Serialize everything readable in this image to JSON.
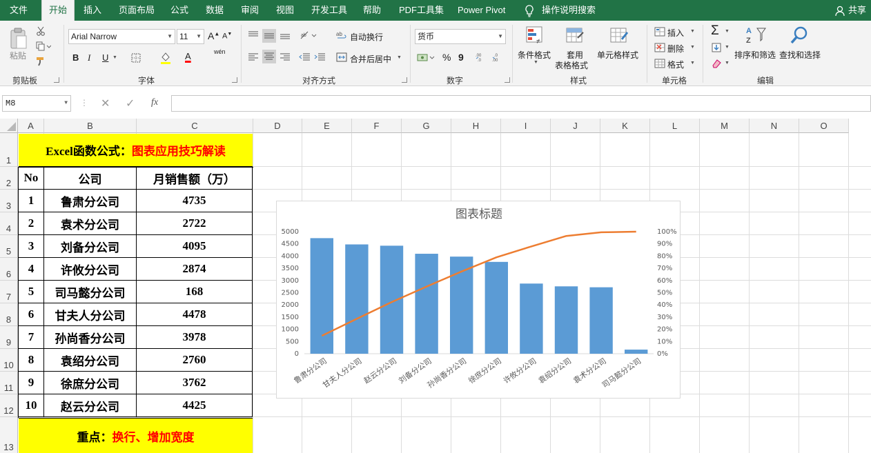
{
  "menu": {
    "tabs": [
      "文件",
      "开始",
      "插入",
      "页面布局",
      "公式",
      "数据",
      "审阅",
      "视图",
      "开发工具",
      "帮助",
      "PDF工具集",
      "Power Pivot"
    ],
    "active_tab": "开始",
    "tell_me": "操作说明搜索",
    "share": "共享"
  },
  "ribbon": {
    "clipboard": {
      "paste": "粘贴",
      "label": "剪贴板"
    },
    "font": {
      "name": "Arial Narrow",
      "size": "11",
      "grow": "A",
      "shrink": "A",
      "bold": "B",
      "italic": "I",
      "underline": "U",
      "color_letter": "A",
      "wen": "wén",
      "label": "字体"
    },
    "alignment": {
      "wrap": "自动换行",
      "merge": "合并后居中",
      "label": "对齐方式"
    },
    "number": {
      "format": "货币",
      "percent": "%",
      "comma": "9",
      "label": "数字"
    },
    "styles": {
      "conditional": "条件格式",
      "table1": "套用",
      "table2": "表格格式",
      "cell_styles": "单元格样式",
      "label": "样式"
    },
    "cells": {
      "insert": "插入",
      "delete": "删除",
      "format": "格式",
      "label": "单元格"
    },
    "editing": {
      "sort": "排序和筛选",
      "find": "查找和选择",
      "label": "编辑"
    }
  },
  "formula_bar": {
    "name_box": "M8",
    "fx": "fx",
    "value": ""
  },
  "columns": [
    "A",
    "B",
    "C",
    "D",
    "E",
    "F",
    "G",
    "H",
    "I",
    "J",
    "K",
    "L",
    "M",
    "N",
    "O"
  ],
  "rows": [
    "1",
    "2",
    "3",
    "4",
    "5",
    "6",
    "7",
    "8",
    "9",
    "10",
    "11",
    "12",
    "13"
  ],
  "sheet": {
    "title_black": "Excel函数公式：",
    "title_red": "图表应用技巧解读",
    "headers": [
      "No",
      "公司",
      "月销售额（万）"
    ],
    "data": [
      {
        "no": "1",
        "company": "鲁肃分公司",
        "sales": "4735"
      },
      {
        "no": "2",
        "company": "袁术分公司",
        "sales": "2722"
      },
      {
        "no": "3",
        "company": "刘备分公司",
        "sales": "4095"
      },
      {
        "no": "4",
        "company": "许攸分公司",
        "sales": "2874"
      },
      {
        "no": "5",
        "company": "司马懿分公司",
        "sales": "168"
      },
      {
        "no": "6",
        "company": "甘夫人分公司",
        "sales": "4478"
      },
      {
        "no": "7",
        "company": "孙尚香分公司",
        "sales": "3978"
      },
      {
        "no": "8",
        "company": "袁绍分公司",
        "sales": "2760"
      },
      {
        "no": "9",
        "company": "徐庶分公司",
        "sales": "3762"
      },
      {
        "no": "10",
        "company": "赵云分公司",
        "sales": "4425"
      }
    ],
    "footer_black": "重点：",
    "footer_red": "换行、增加宽度"
  },
  "colors": {
    "excel_green": "#217346",
    "bar": "#5b9bd5",
    "line": "#ed7d31",
    "yellow": "#ffff00",
    "red": "#ff0000"
  },
  "chart_data": {
    "type": "bar",
    "title": "图表标题",
    "categories": [
      "鲁肃分公司",
      "甘夫人分公司",
      "赵云分公司",
      "刘备分公司",
      "孙尚香分公司",
      "徐庶分公司",
      "许攸分公司",
      "袁绍分公司",
      "袁术分公司",
      "司马懿分公司"
    ],
    "series": [
      {
        "type": "bar",
        "axis": "primary",
        "values": [
          4735,
          4478,
          4425,
          4095,
          3978,
          3762,
          2874,
          2760,
          2722,
          168
        ]
      },
      {
        "type": "line",
        "axis": "secondary",
        "values": [
          0.1469,
          0.2858,
          0.423,
          0.55,
          0.6734,
          0.7901,
          0.8792,
          0.9648,
          0.9948,
          1.0
        ]
      }
    ],
    "ylim": [
      0,
      5000
    ],
    "yticks": [
      "0",
      "500",
      "1000",
      "1500",
      "2000",
      "2500",
      "3000",
      "3500",
      "4000",
      "4500",
      "5000"
    ],
    "y2lim": [
      0,
      1
    ],
    "y2ticks": [
      "0%",
      "10%",
      "20%",
      "30%",
      "40%",
      "50%",
      "60%",
      "70%",
      "80%",
      "90%",
      "100%"
    ],
    "grid": false
  }
}
